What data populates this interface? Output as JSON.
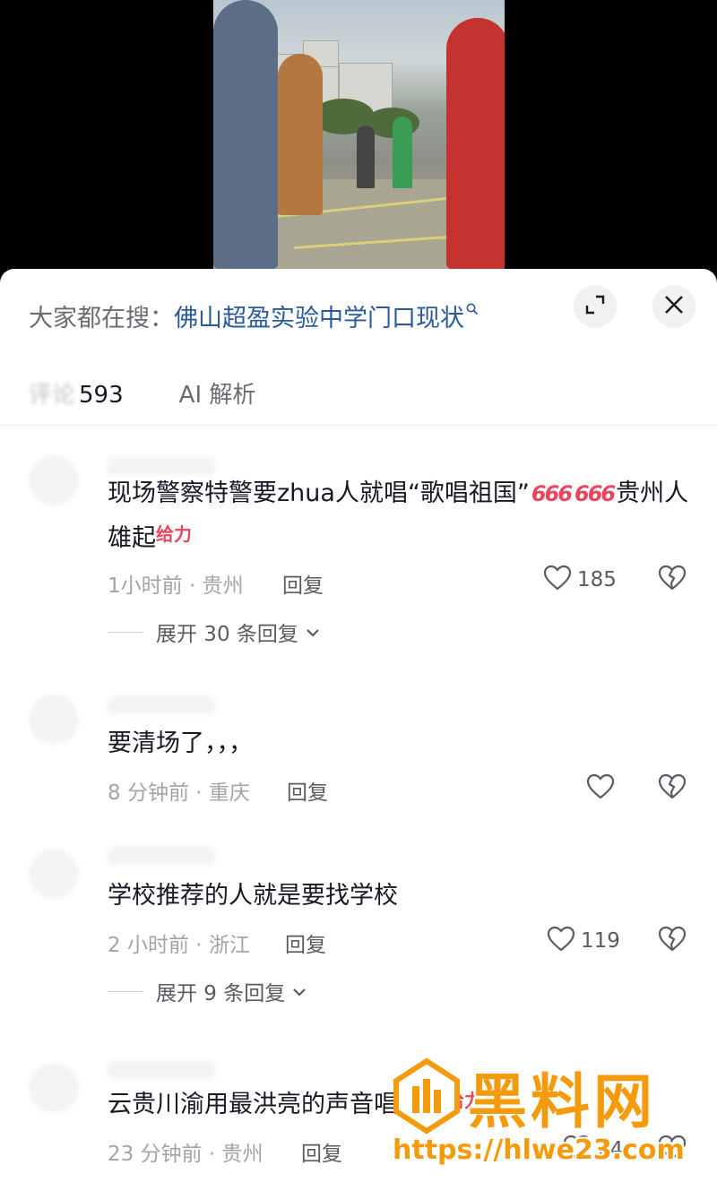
{
  "search": {
    "prefix": "大家都在搜：",
    "query": "佛山超盈实验中学门口现状"
  },
  "tabs": {
    "comments_label": "评论",
    "comments_count": "593",
    "ai_label": "AI 解析"
  },
  "comments": [
    {
      "text_before": "现场警察特警要zhua人就唱“歌唱祖国”",
      "text_after": "贵州人雄起",
      "emojis": [
        "666",
        "666",
        "给力"
      ],
      "time_location": "1小时前 · 贵州",
      "reply_label": "回复",
      "like_count": "185",
      "expand_label": "展开 30 条回复"
    },
    {
      "text": "要清场了，，，",
      "time_location": "8 分钟前 · 重庆",
      "reply_label": "回复",
      "like_count": ""
    },
    {
      "text": "学校推荐的人就是要找学校",
      "time_location": "2 小时前 · 浙江",
      "reply_label": "回复",
      "like_count": "119",
      "expand_label": "展开 9 条回复"
    },
    {
      "text": "云贵川渝用最洪亮的声音唱起来",
      "emojis": [
        "给力"
      ],
      "time_location": "23 分钟前 · 贵州",
      "reply_label": "回复",
      "like_count": "24"
    }
  ],
  "watermark": {
    "title": "黑料网",
    "url": "https://hlwe23.com"
  },
  "icons": {
    "expand": "expand-icon",
    "close": "close-icon",
    "search": "search-icon",
    "like": "heart-icon",
    "dislike": "broken-heart-icon",
    "chevron": "chevron-down-icon"
  },
  "colors": {
    "link": "#2a5a99",
    "emoji": "#e9455c",
    "watermark": "#f39b0c"
  }
}
